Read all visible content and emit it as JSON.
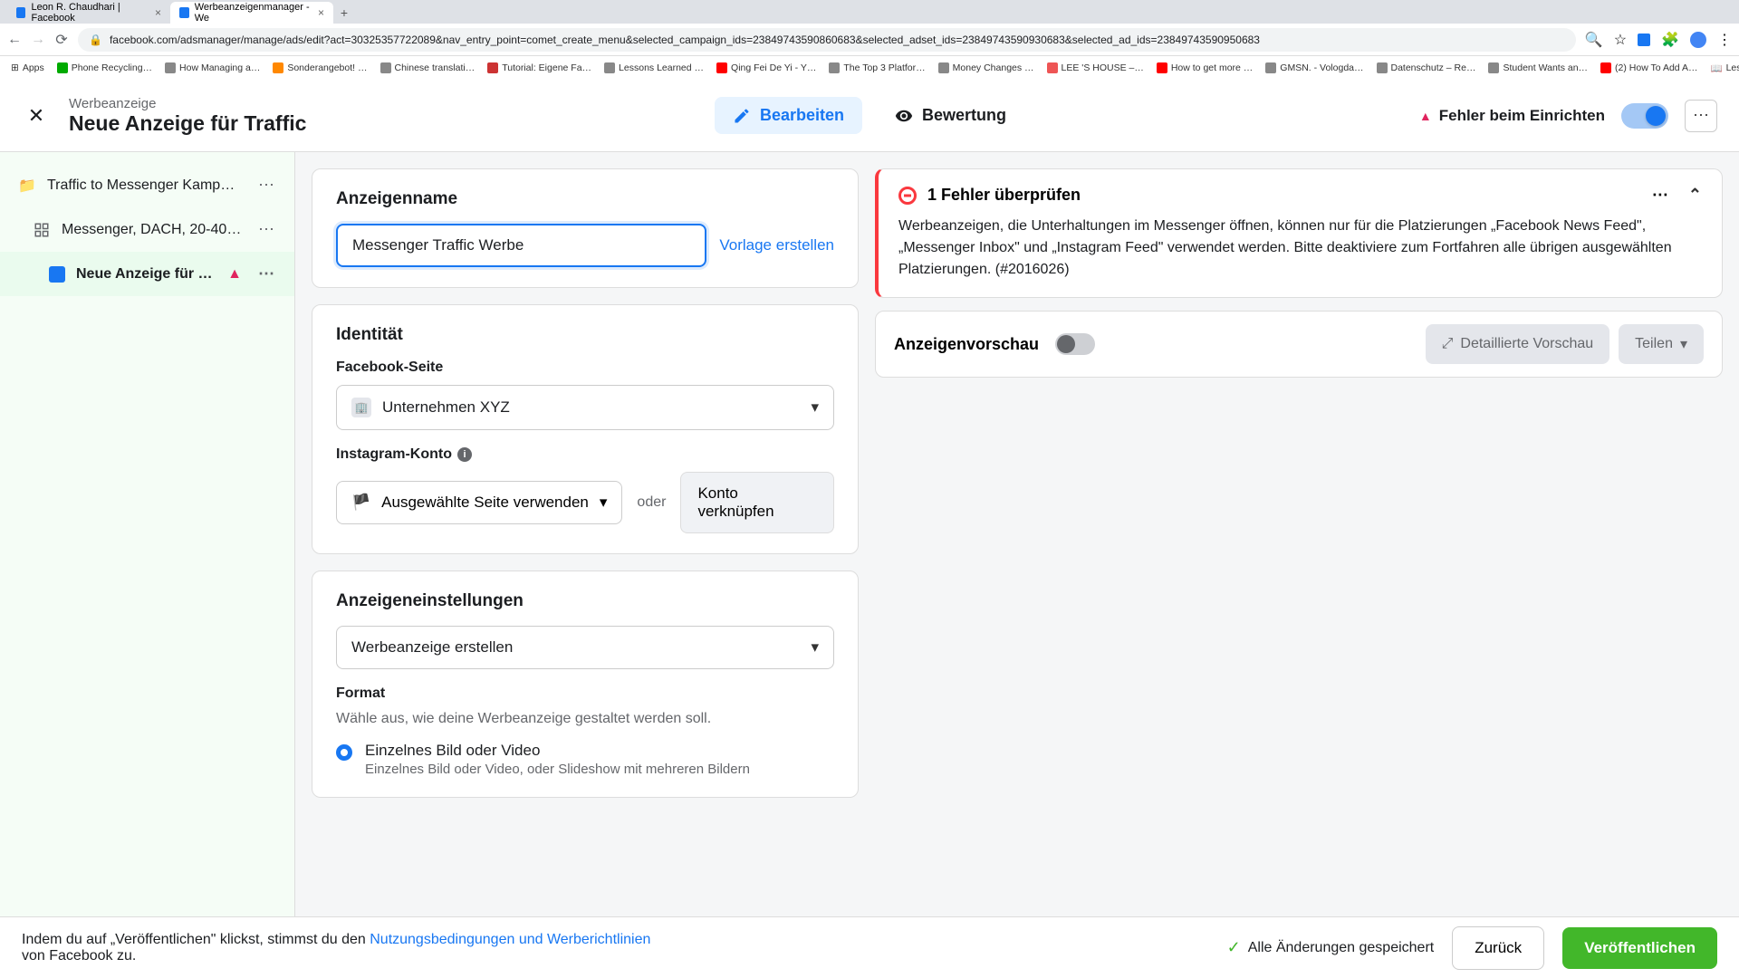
{
  "browser": {
    "tabs": [
      {
        "title": "Leon R. Chaudhari | Facebook",
        "icon": "#1877f2"
      },
      {
        "title": "Werbeanzeigenmanager - We",
        "icon": "#1877f2"
      }
    ],
    "url": "facebook.com/adsmanager/manage/ads/edit?act=30325357722089&nav_entry_point=comet_create_menu&selected_campaign_ids=23849743590860683&selected_adset_ids=23849743590930683&selected_ad_ids=23849743590950683",
    "bookmarks": [
      "Apps",
      "Phone Recycling…",
      "How Managing a…",
      "Sonderangebot! …",
      "Chinese translati…",
      "Tutorial: Eigene Fa…",
      "Lessons Learned …",
      "Qing Fei De Yi - Y…",
      "The Top 3 Platfor…",
      "Money Changes …",
      "LEE 'S HOUSE –…",
      "How to get more …",
      "GMSN. - Vologda…",
      "Datenschutz – Re…",
      "Student Wants an…",
      "(2) How To Add A…",
      "Leseliste"
    ]
  },
  "header": {
    "subtitle": "Werbeanzeige",
    "title": "Neue Anzeige für Traffic",
    "tab_edit": "Bearbeiten",
    "tab_review": "Bewertung",
    "error_label": "Fehler beim Einrichten"
  },
  "sidebar": {
    "campaign": "Traffic to Messenger Kampa…",
    "adset": "Messenger, DACH, 20-40, …",
    "ad": "Neue Anzeige für Tr…"
  },
  "form": {
    "name_heading": "Anzeigenname",
    "name_value": "Messenger Traffic Werbe",
    "create_template": "Vorlage erstellen",
    "identity_heading": "Identität",
    "fb_page_label": "Facebook-Seite",
    "fb_page_value": "Unternehmen XYZ",
    "ig_label": "Instagram-Konto",
    "ig_value": "Ausgewählte Seite verwenden",
    "oder": "oder",
    "link_account": "Konto verknüpfen",
    "settings_heading": "Anzeigeneinstellungen",
    "settings_value": "Werbeanzeige erstellen",
    "format_label": "Format",
    "format_desc": "Wähle aus, wie deine Werbeanzeige gestaltet werden soll.",
    "format_opt1": "Einzelnes Bild oder Video",
    "format_opt1_sub": "Einzelnes Bild oder Video, oder Slideshow mit mehreren Bildern"
  },
  "errors": {
    "heading": "1 Fehler überprüfen",
    "body": "Werbeanzeigen, die Unterhaltungen im Messenger öffnen, können nur für die Platzierungen „Facebook News Feed\", „Messenger Inbox\" und „Instagram Feed\" verwendet werden. Bitte deaktiviere zum Fortfahren alle übrigen ausgewählten Platzierungen. (#2016026)"
  },
  "preview": {
    "title": "Anzeigenvorschau",
    "detailed": "Detaillierte Vorschau",
    "share": "Teilen"
  },
  "footer": {
    "text_prefix": "Indem du auf „Veröffentlichen\" klickst, stimmst du den ",
    "terms_link": "Nutzungsbedingungen und Werberichtlinien",
    "text_suffix": " von Facebook zu.",
    "saved": "Alle Änderungen gespeichert",
    "back": "Zurück",
    "publish": "Veröffentlichen"
  }
}
